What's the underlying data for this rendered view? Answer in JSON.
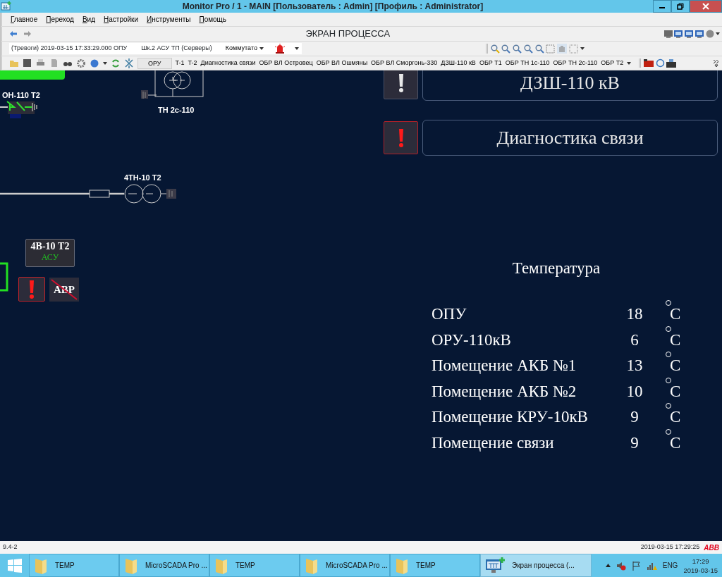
{
  "window": {
    "title": "Monitor Pro / 1 - MAIN [Пользователь : Admin] [Профиль : Administrator]"
  },
  "menu": [
    "Главное",
    "Переход",
    "Вид",
    "Настройки",
    "Инструменты",
    "Помощь"
  ],
  "screen_title": "ЭКРАН ПРОЦЕССА",
  "alarm_bar": {
    "alarm_text": "(Тревоги) 2019-03-15 17:33:29.000 ОПУ",
    "source": "Шк.2 АСУ ТП (Серверы)",
    "filter": "Коммутато"
  },
  "toolbar": {
    "button": "ОРУ",
    "links": [
      "T-1",
      "T-2",
      "Диагностика связи",
      "ОБР ВЛ Островец",
      "ОБР ВЛ Ошмяны",
      "ОБР ВЛ Сморгонь-330",
      "ДЗШ-110 кВ",
      "ОБР Т1",
      "ОБР ТН 1с-110",
      "ОБР ТН 2с-110",
      "ОБР Т2"
    ]
  },
  "diagram": {
    "disconnector_label": "ОН-110 Т2",
    "vt_label": "ТН 2с-110",
    "vt10_label": "4ТН-10 Т2",
    "breaker": {
      "name": "4В-10 Т2",
      "mode": "АСУ"
    },
    "alarm_button": {
      "alarm": true
    },
    "avr": {
      "label": "АВР",
      "blocked": true
    }
  },
  "alarm_panels": [
    {
      "label": "ДЗШ-110 кВ",
      "alarm": false
    },
    {
      "label": "Диагностика связи",
      "alarm": true
    }
  ],
  "temperature": {
    "title": "Температура",
    "rows": [
      {
        "name": "ОПУ",
        "value": "18",
        "unit": "C"
      },
      {
        "name": "ОРУ-110кВ",
        "value": "6",
        "unit": "C"
      },
      {
        "name": "Помещение АКБ №1",
        "value": "13",
        "unit": "C"
      },
      {
        "name": "Помещение АКБ №2",
        "value": "10",
        "unit": "C"
      },
      {
        "name": "Помещение КРУ-10кВ",
        "value": "9",
        "unit": "C"
      },
      {
        "name": "Помещение связи",
        "value": "9",
        "unit": "C"
      }
    ]
  },
  "status_bar": {
    "version": "9.4-2",
    "datetime": "2019-03-15 17:29:25",
    "logo": "ABB"
  },
  "taskbar": {
    "items": [
      {
        "label": "TEMP",
        "kind": "folder",
        "selected": false
      },
      {
        "label": "MicroSCADA Pro ...",
        "kind": "folder",
        "selected": false
      },
      {
        "label": "TEMP",
        "kind": "folder",
        "selected": false
      },
      {
        "label": "MicroSCADA Pro ...",
        "kind": "folder",
        "selected": false
      },
      {
        "label": "TEMP",
        "kind": "folder",
        "selected": false
      },
      {
        "label": "Экран процесса (...",
        "kind": "app",
        "selected": true
      }
    ],
    "tray": {
      "language": "ENG",
      "time": "17:29",
      "date": "2019-03-15"
    }
  }
}
